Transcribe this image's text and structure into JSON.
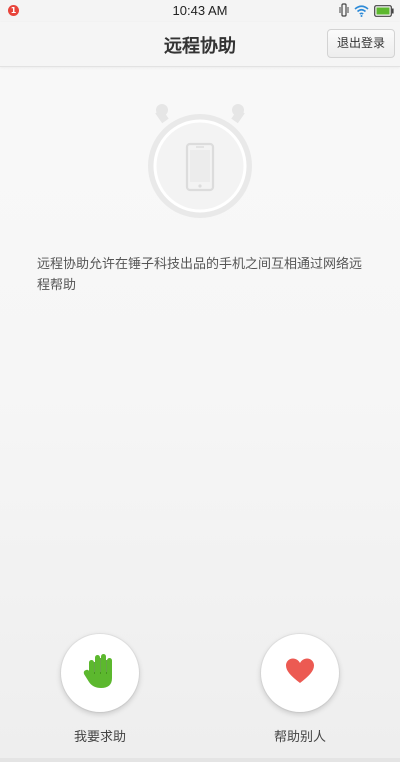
{
  "status_bar": {
    "notification_count": "1",
    "time": "10:43 AM",
    "icons": [
      "vibrate-icon",
      "wifi-icon",
      "battery-icon"
    ],
    "battery_color": "#5cb82e"
  },
  "header": {
    "title": "远程协助",
    "logout_label": "退出登录"
  },
  "main": {
    "hero_icon": "phone-in-stopwatch-icon",
    "description": "远程协助允许在锤子科技出品的手机之间互相通过网络远程帮助"
  },
  "actions": {
    "request_help_label": "我要求助",
    "request_help_icon": "raised-hand-icon",
    "request_help_color": "#5cb82e",
    "help_others_label": "帮助别人",
    "help_others_icon": "heart-icon",
    "help_others_color": "#ec5a52"
  }
}
